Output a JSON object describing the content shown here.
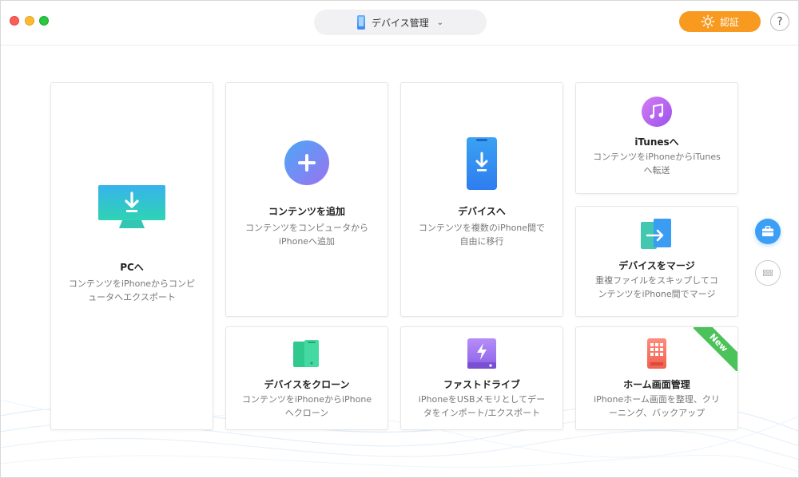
{
  "header": {
    "device_label": "デバイス管理",
    "device_chevron": "⌄",
    "auth_label": "認証",
    "help_label": "?"
  },
  "cards": {
    "to_pc": {
      "title": "PCへ",
      "desc1": "コンテンツをiPhoneからコンピ",
      "desc2": "ュータへエクスポート"
    },
    "add_content": {
      "title": "コンテンツを追加",
      "desc1": "コンテンツをコンピュータから",
      "desc2": "iPhoneへ追加"
    },
    "to_device": {
      "title": "デバイスへ",
      "desc1": "コンテンツを複数のiPhone間で",
      "desc2": "自由に移行"
    },
    "to_itunes": {
      "title": "iTunesへ",
      "desc1": "コンテンツをiPhoneからiTunes",
      "desc2": "へ転送"
    },
    "merge_device": {
      "title": "デバイスをマージ",
      "desc1": "重複ファイルをスキップしてコ",
      "desc2": "ンテンツをiPhone間でマージ"
    },
    "clone_device": {
      "title": "デバイスをクローン",
      "desc1": "コンテンツをiPhoneからiPhone",
      "desc2": "へクローン"
    },
    "fast_drive": {
      "title": "ファストドライブ",
      "desc1": "iPhoneをUSBメモリとしてデー",
      "desc2": "タをインポート/エクスポート"
    },
    "home_screen": {
      "title": "ホーム画面管理",
      "desc1": "iPhoneホーム画面を整理、クリ",
      "desc2": "ーニング、バックアップ",
      "badge": "New"
    }
  },
  "colors": {
    "accent_orange": "#f79a1f",
    "accent_blue": "#3c9ff5",
    "badge_green": "#4cc25a"
  }
}
